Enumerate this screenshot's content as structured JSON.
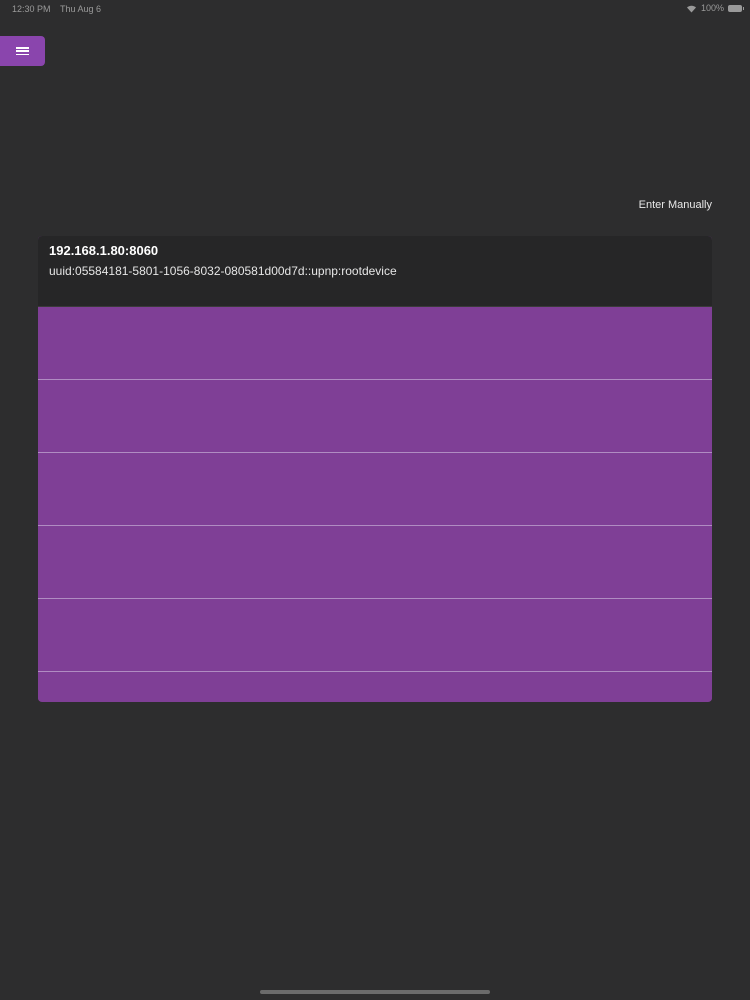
{
  "status_bar": {
    "time": "12:30 PM",
    "date": "Thu Aug 6",
    "battery_text": "100%"
  },
  "toolbar": {
    "menu_icon": "hamburger-icon"
  },
  "enter_manually_label": "Enter Manually",
  "device": {
    "address": "192.168.1.80:8060",
    "uuid": "uuid:05584181-5801-1056-8032-080581d00d7d::upnp:rootdevice"
  },
  "rows": [
    {
      "label": ""
    },
    {
      "label": ""
    },
    {
      "label": ""
    },
    {
      "label": ""
    },
    {
      "label": ""
    },
    {
      "label": ""
    }
  ],
  "colors": {
    "background": "#2d2d2e",
    "accent": "#8a45ad",
    "row_fill": "#7f3f96",
    "header_fill": "#262627"
  }
}
